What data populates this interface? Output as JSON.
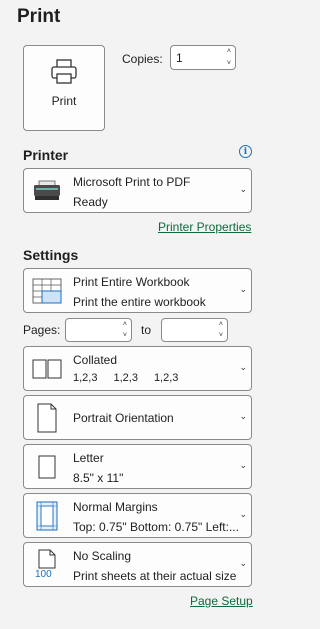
{
  "header": {
    "title": "Print"
  },
  "print_button": {
    "label": "Print"
  },
  "copies": {
    "label": "Copies:",
    "value": "1"
  },
  "printer": {
    "section_title": "Printer",
    "name": "Microsoft Print to PDF",
    "status": "Ready",
    "properties_link": "Printer Properties",
    "info_icon_glyph": "i"
  },
  "settings": {
    "section_title": "Settings",
    "scope": {
      "title": "Print Entire Workbook",
      "subtitle": "Print the entire workbook"
    },
    "pages": {
      "label": "Pages:",
      "to_label": "to",
      "from_value": "",
      "to_value": ""
    },
    "collation": {
      "title": "Collated",
      "sequence": [
        "1,2,3",
        "1,2,3",
        "1,2,3"
      ]
    },
    "orientation": {
      "title": "Portrait Orientation"
    },
    "paper": {
      "title": "Letter",
      "subtitle": "8.5\" x 11\""
    },
    "margins": {
      "title": "Normal Margins",
      "subtitle": "Top: 0.75\" Bottom: 0.75\" Left:..."
    },
    "scaling": {
      "title": "No Scaling",
      "subtitle": "Print sheets at their actual size",
      "icon_text": "100"
    },
    "page_setup_link": "Page Setup"
  },
  "glyphs": {
    "chevron_down": "⌄",
    "spin_up": "˄",
    "spin_down": "˅"
  },
  "colors": {
    "link": "#0f6a3c",
    "info": "#1a6fc2",
    "accent_blue": "#1a6fc2"
  }
}
